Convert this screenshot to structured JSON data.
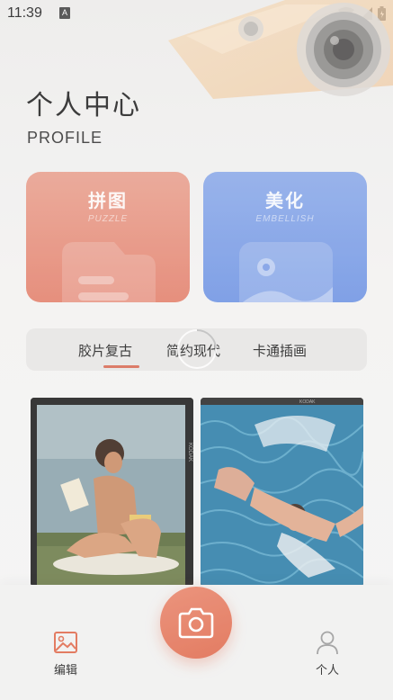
{
  "status_bar": {
    "time": "11:39",
    "sim_label": "A"
  },
  "header": {
    "title": "个人中心",
    "subtitle": "PROFILE"
  },
  "cards": [
    {
      "title": "拼图",
      "subtitle": "PUZZLE",
      "icon": "document-folder-icon",
      "color": "#e3806c"
    },
    {
      "title": "美化",
      "subtitle": "EMBELLISH",
      "icon": "image-frame-icon",
      "color": "#6f94e3"
    }
  ],
  "tabs": {
    "items": [
      "胶片复古",
      "简约现代",
      "卡通插画"
    ],
    "active_index": 0,
    "accent": "#d86a55"
  },
  "bottom_nav": {
    "edit_label": "编辑",
    "profile_label": "个人",
    "accent": "#e06a4d"
  }
}
